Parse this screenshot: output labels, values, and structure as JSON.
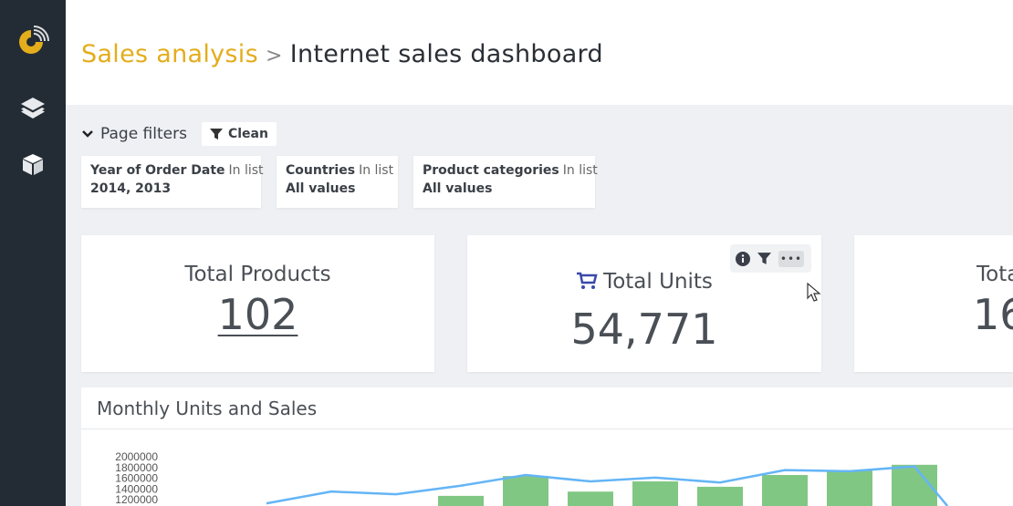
{
  "sidebar": {
    "items": [
      {
        "icon": "logo-icon"
      },
      {
        "icon": "layers-icon"
      },
      {
        "icon": "cube-icon"
      }
    ]
  },
  "header": {
    "breadcrumb_parent": "Sales analysis",
    "separator": ">",
    "title": "Internet sales dashboard"
  },
  "filters": {
    "toggle_label": "Page filters",
    "clean_label": "Clean",
    "chips": [
      {
        "name": "Year of Order Date",
        "op": "In list",
        "value": "2014, 2013"
      },
      {
        "name": "Countries",
        "op": "In list",
        "value": "All values"
      },
      {
        "name": "Product categories",
        "op": "In list",
        "value": "All values"
      }
    ]
  },
  "kpis": [
    {
      "title": "Total Products",
      "value": "102"
    },
    {
      "title": "Total Units",
      "value": "54,771",
      "icon": "cart-icon"
    },
    {
      "title": "Tota",
      "value": "16"
    }
  ],
  "colors": {
    "accent": "#e3ad1c",
    "sidebar": "#232c34",
    "bar": "#81c784",
    "line": "#64b5f6",
    "cart": "#3949ab"
  },
  "chart_data": {
    "type": "bar+line",
    "title": "Monthly Units and Sales",
    "yticks": [
      "2000000",
      "1800000",
      "1600000",
      "1400000",
      "1200000"
    ],
    "ylim": [
      1000000,
      2000000
    ],
    "bars": [
      1270000,
      1640000,
      1350000,
      1540000,
      1440000,
      1660000,
      1750000,
      1850000
    ],
    "line": [
      1130000,
      1350000,
      1300000,
      1460000,
      1660000,
      1540000,
      1610000,
      1520000,
      1750000,
      1730000,
      1820000,
      900000
    ]
  }
}
